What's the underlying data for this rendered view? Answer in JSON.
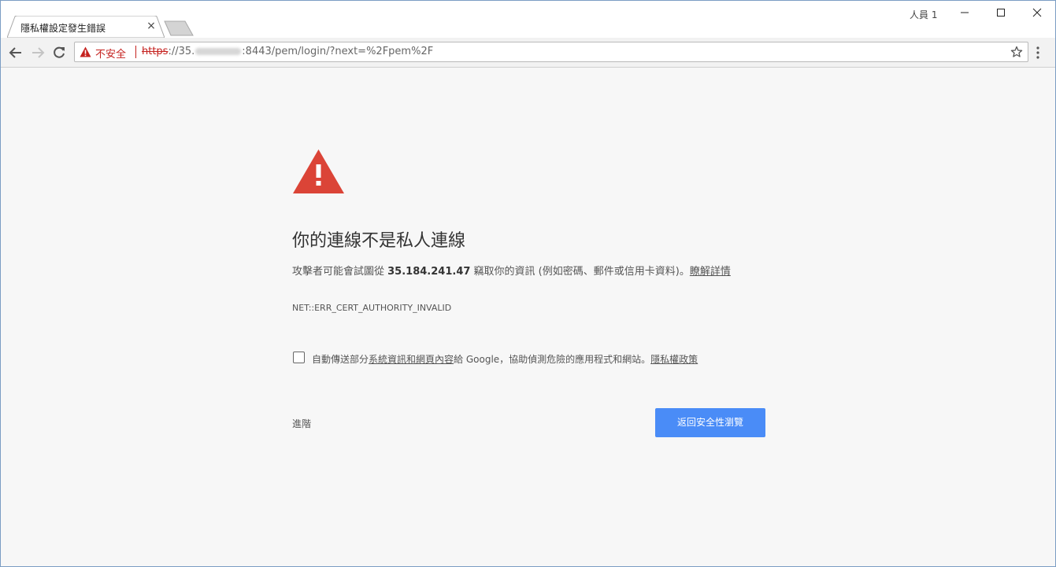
{
  "browser": {
    "tab_title": "隱私權設定發生錯誤",
    "tab_close": "×",
    "profile_label": "人員 1"
  },
  "omnibox": {
    "security_label": "不安全",
    "url_scheme": "https",
    "url_sep": "://",
    "url_host_prefix": "35.",
    "url_rest": ":8443/pem/login/?next=%2Fpem%2F"
  },
  "interstitial": {
    "heading": "你的連線不是私人連線",
    "body_pre": "攻擊者可能會試圖從 ",
    "body_host": "35.184.241.47",
    "body_post": " 竊取你的資訊 (例如密碼、郵件或信用卡資料)。",
    "learn_more": "瞭解詳情",
    "error_code": "NET::ERR_CERT_AUTHORITY_INVALID",
    "optin_pre": "自動傳送部分",
    "optin_link": "系統資訊和網頁內容",
    "optin_mid": "給 Google，協助偵測危險的應用程式和網站。",
    "optin_privacy": "隱私權政策",
    "advanced_label": "進階",
    "back_button": "返回安全性瀏覽"
  },
  "colors": {
    "danger_red": "#db4437",
    "primary_blue": "#4a8cf7",
    "insecure_red": "#c5221f"
  }
}
